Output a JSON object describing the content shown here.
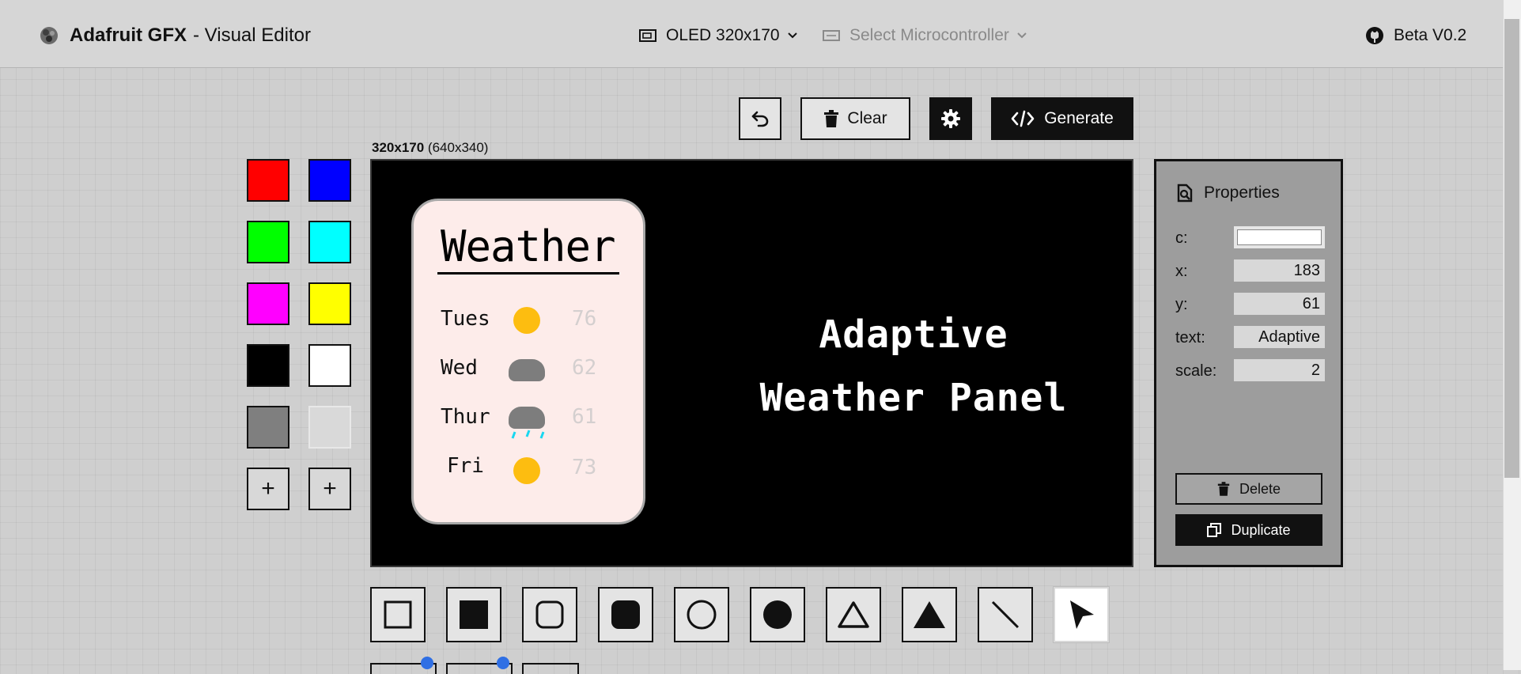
{
  "header": {
    "app_name": "Adafruit GFX",
    "app_subtitle": "- Visual Editor",
    "display_select": "OLED 320x170",
    "microcontroller_select": "Select Microcontroller",
    "version": "Beta V0.2"
  },
  "toolbar": {
    "undo_icon": "undo-icon",
    "clear_label": "Clear",
    "settings_icon": "gear-icon",
    "generate_label": "Generate"
  },
  "canvas": {
    "size_label": "320x170",
    "scaled_label": "(640x340)",
    "card": {
      "title": "Weather",
      "days": [
        {
          "day": "Tues",
          "icon": "sun",
          "temp": "76"
        },
        {
          "day": "Wed",
          "icon": "cloud",
          "temp": "62"
        },
        {
          "day": "Thur",
          "icon": "rain-cloud",
          "temp": "61"
        },
        {
          "day": "Fri",
          "icon": "sun",
          "temp": "73"
        }
      ]
    },
    "panel_line1": "Adaptive",
    "panel_line2": "Weather Panel"
  },
  "palette": {
    "colors": [
      "#ff0000",
      "#0000ff",
      "#00ff00",
      "#00ffff",
      "#ff00ff",
      "#ffff00",
      "#000000",
      "#ffffff",
      "#7f7f7f",
      "#d9d9d9"
    ],
    "add_label": "+"
  },
  "properties": {
    "title": "Properties",
    "c_label": "c:",
    "c_value": "#ffffff",
    "x_label": "x:",
    "x_value": "183",
    "y_label": "y:",
    "y_value": "61",
    "text_label": "text:",
    "text_value": "Adaptive",
    "scale_label": "scale:",
    "scale_value": "2",
    "delete_label": "Delete",
    "duplicate_label": "Duplicate"
  },
  "tools": [
    "rectangle-outline",
    "rectangle-filled",
    "rounded-rect-outline",
    "rounded-rect-filled",
    "circle-outline",
    "circle-filled",
    "triangle-outline",
    "triangle-filled",
    "line",
    "select-pointer"
  ],
  "selected_tool": "select-pointer"
}
